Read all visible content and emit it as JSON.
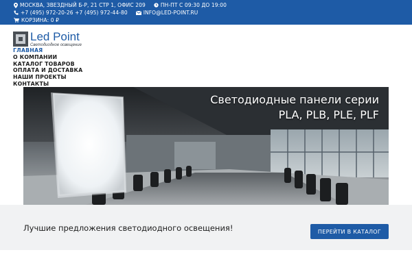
{
  "topbar": {
    "address": "МОСКВА, ЗВЕЗДНЫЙ Б-Р, 21 СТР 1, ОФИС 209",
    "hours": "ПН-ПТ С 09:30 ДО 19:00",
    "phones": "+7 (495) 972-20-26 +7 (495) 972-44-80",
    "email": "INFO@LED-POINT.RU",
    "cart": "КОРЗИНА: 0 ₽"
  },
  "logo": {
    "name": "Led Point",
    "tagline": "Светодиодное освещение"
  },
  "nav": {
    "items": [
      {
        "label": "ГЛАВНАЯ"
      },
      {
        "label": "О КОМПАНИИ"
      },
      {
        "label": "КАТАЛОГ ТОВАРОВ"
      },
      {
        "label": "ОПЛАТА И ДОСТАВКА"
      },
      {
        "label": "НАШИ ПРОЕКТЫ"
      },
      {
        "label": "КОНТАКТЫ"
      }
    ]
  },
  "banner": {
    "line1": "Светодиодные панели серии",
    "line2": "PLA, PLB, PLE, PLF"
  },
  "cta": {
    "text": "Лучшие предложения светодиодного освещения!",
    "button": "ПЕРЕЙТИ В КАТАЛОГ"
  },
  "colors": {
    "brand": "#1e5ba6",
    "band": "#f1f2f3"
  }
}
